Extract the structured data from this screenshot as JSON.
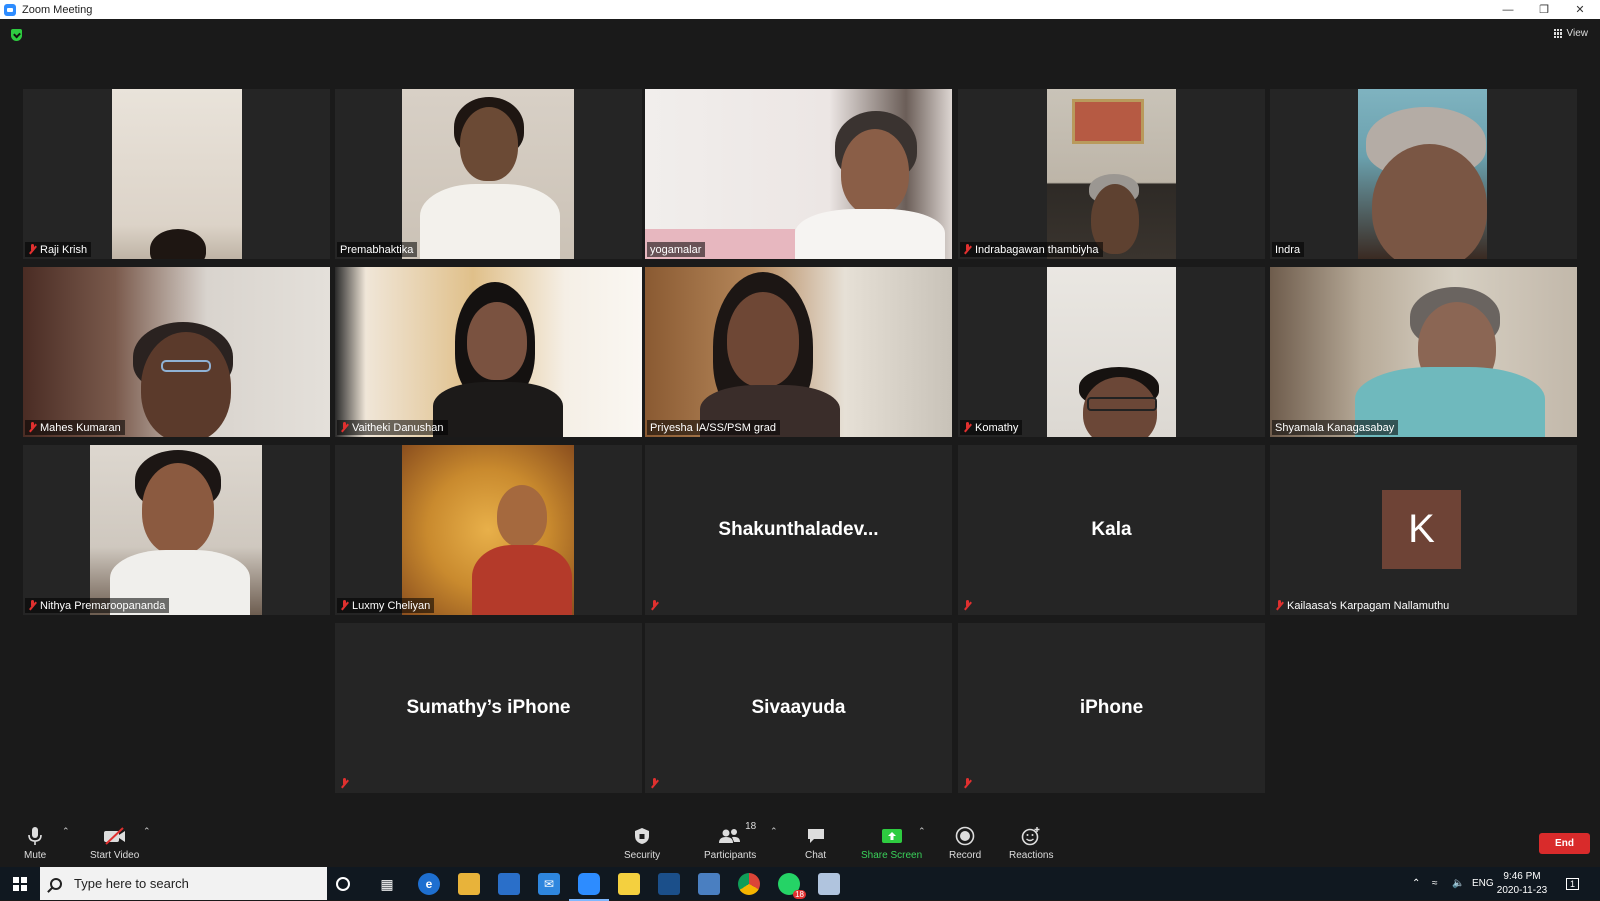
{
  "window": {
    "title": "Zoom Meeting"
  },
  "meeting": {
    "view_label": "View"
  },
  "participants": [
    {
      "name": "Raji Krish",
      "muted": true,
      "video": true
    },
    {
      "name": "Premabhaktika",
      "muted": false,
      "video": true
    },
    {
      "name": "yogamalar",
      "muted": false,
      "video": true,
      "speaking": true
    },
    {
      "name": "Indrabagawan thambiyha",
      "muted": true,
      "video": true
    },
    {
      "name": "Indra",
      "muted": false,
      "video": true
    },
    {
      "name": "Mahes Kumaran",
      "muted": true,
      "video": true
    },
    {
      "name": "Vaitheki Danushan",
      "muted": true,
      "video": true
    },
    {
      "name": "Priyesha IA/SS/PSM grad",
      "muted": false,
      "video": true
    },
    {
      "name": "Komathy",
      "muted": true,
      "video": true
    },
    {
      "name": "Shyamala Kanagasabay",
      "muted": false,
      "video": true
    },
    {
      "name": "Nithya Premaroopananda",
      "muted": true,
      "video": true
    },
    {
      "name": "Luxmy Cheliyan",
      "muted": true,
      "video": true
    },
    {
      "name": "Shakunthaladev...",
      "muted": true,
      "video": false
    },
    {
      "name": "Kala",
      "muted": true,
      "video": false
    },
    {
      "name": "Kailaasa's Karpagam Nallamuthu",
      "muted": true,
      "video": false,
      "avatar_letter": "K"
    },
    {
      "name": "Sumathy’s iPhone",
      "muted": true,
      "video": false
    },
    {
      "name": "Sivaayuda",
      "muted": true,
      "video": false
    },
    {
      "name": "iPhone",
      "muted": true,
      "video": false
    }
  ],
  "toolbar": {
    "mute": "Mute",
    "start_video": "Start Video",
    "security": "Security",
    "participants": "Participants",
    "participants_count": "18",
    "chat": "Chat",
    "share_screen": "Share Screen",
    "record": "Record",
    "reactions": "Reactions",
    "end": "End"
  },
  "taskbar": {
    "search_placeholder": "Type here to search",
    "language": "ENG",
    "time": "9:46 PM",
    "date": "2020-11-23",
    "whatsapp_badge": "18",
    "notification_count": "1"
  }
}
